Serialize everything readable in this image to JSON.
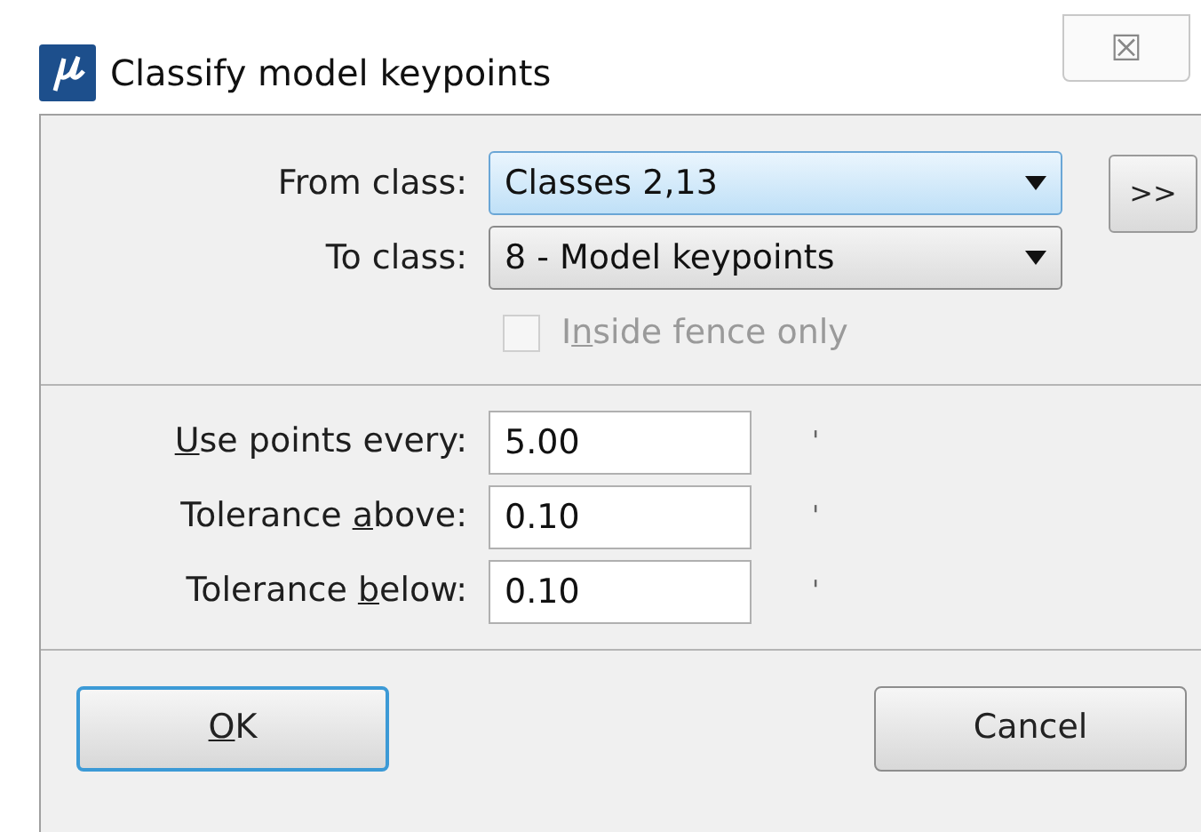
{
  "window": {
    "title": "Classify model keypoints",
    "close": "☒"
  },
  "from_class": {
    "label": "From class:",
    "value": "Classes 2,13",
    "focused": true
  },
  "to_class": {
    "label": "To class:",
    "value": "8 - Model keypoints",
    "focused": false
  },
  "more_button": ">>",
  "inside_fence": {
    "before": "I",
    "mnemonic": "n",
    "after": "side fence only",
    "checked": false,
    "disabled": true
  },
  "fields": [
    {
      "mnemonic": "U",
      "after": "se points every:",
      "value": "5.00",
      "unit": "'"
    },
    {
      "before": "Tolerance ",
      "mnemonic": "a",
      "after": "bove:",
      "value": "0.10",
      "unit": "'"
    },
    {
      "before": "Tolerance ",
      "mnemonic": "b",
      "after": "elow:",
      "value": "0.10",
      "unit": "'"
    }
  ],
  "buttons": [
    {
      "mnemonic": "O",
      "after": "K",
      "default": true
    },
    {
      "after": "Cancel",
      "default": false
    }
  ]
}
